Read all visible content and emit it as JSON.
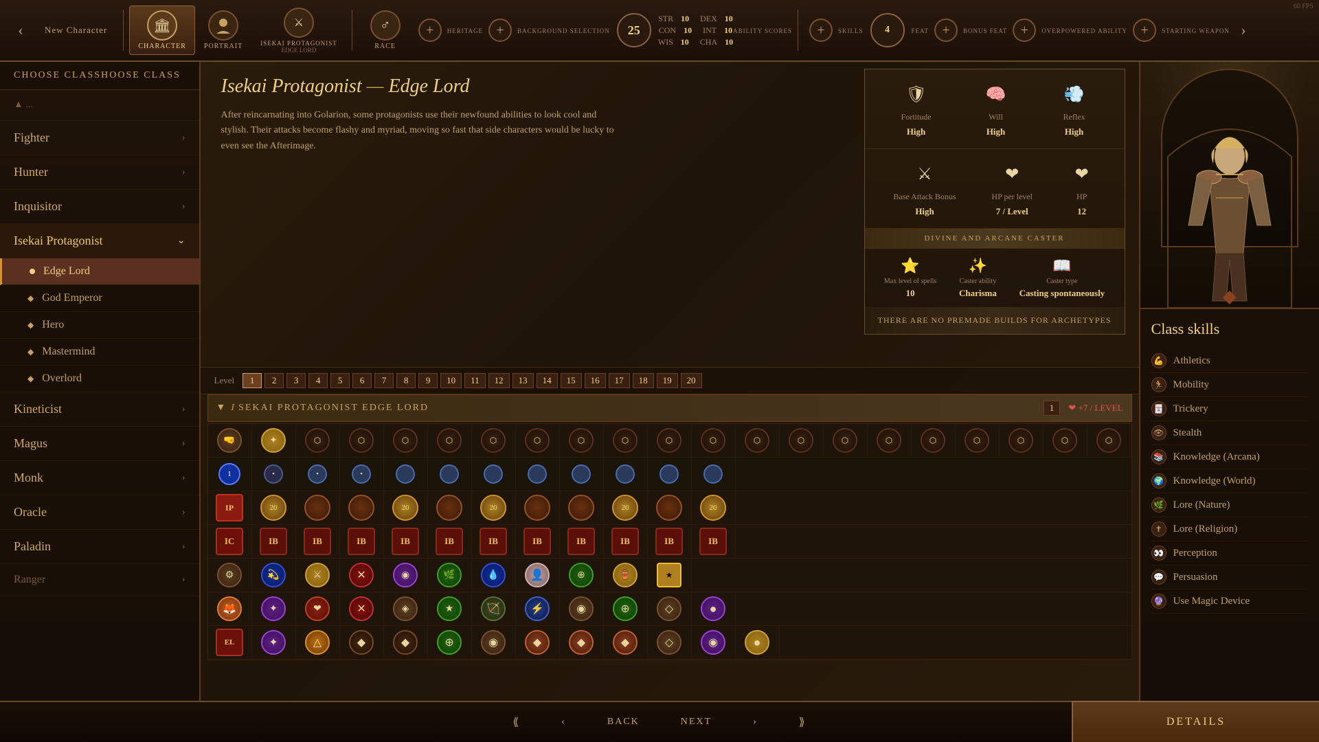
{
  "fps": "60 FPS",
  "header": {
    "new_char_label": "New Character",
    "tabs": [
      {
        "id": "character",
        "label": "CHARACTER",
        "subtitle": "",
        "icon": "🏛",
        "active": true
      },
      {
        "id": "portrait",
        "label": "PORTRAIT",
        "subtitle": "",
        "icon": "👤",
        "active": false
      },
      {
        "id": "protagonist",
        "label": "ISEKAI PROTAGONIST",
        "subtitle": "EDGE LORD",
        "icon": "⚔",
        "active": false
      },
      {
        "id": "race",
        "label": "RACE",
        "subtitle": "",
        "icon": "♂",
        "active": false
      }
    ],
    "plus_buttons": 4,
    "ability_scores_label": "ABILITY SCORES",
    "skills_label": "SKILLS",
    "feat_label": "FEAT",
    "bonus_feat_label": "BONUS FEAT",
    "overpowered_ability_label": "OVERPOWERED ABILITY",
    "starting_weapon_label": "STARTING WEAPON",
    "stats": {
      "STR": 10,
      "DEX": 10,
      "CON": 10,
      "INT": 10,
      "WIS": 10,
      "CHA": 10
    },
    "bg_selection_label": "BACKGROUND SELECTION",
    "circle_25": 25,
    "circle_4": 4
  },
  "left_panel": {
    "choose_class_label": "CHOOSE CLASS",
    "classes": [
      {
        "name": "Fighter",
        "expanded": false
      },
      {
        "name": "Hunter",
        "expanded": false
      },
      {
        "name": "Inquisitor",
        "expanded": false
      },
      {
        "name": "Isekai Protagonist",
        "expanded": true,
        "subclasses": [
          {
            "name": "Edge Lord",
            "selected": true
          },
          {
            "name": "God Emperor",
            "selected": false
          },
          {
            "name": "Hero",
            "selected": false
          },
          {
            "name": "Mastermind",
            "selected": false
          },
          {
            "name": "Overlord",
            "selected": false
          }
        ]
      },
      {
        "name": "Kineticist",
        "expanded": false
      },
      {
        "name": "Magus",
        "expanded": false
      },
      {
        "name": "Monk",
        "expanded": false
      },
      {
        "name": "Oracle",
        "expanded": false
      },
      {
        "name": "Paladin",
        "expanded": false
      },
      {
        "name": "Ranger",
        "expanded": false
      }
    ]
  },
  "center_panel": {
    "class_title": "Isekai Protagonist",
    "class_subtitle": "Edge Lord",
    "description": "After reincarnating into Golarion, some protagonists use their newfound abilities to look cool and stylish. Their attacks become flashy and myriad, moving so fast that side characters would be lucky to even see the Afterimage.",
    "stats": {
      "fortitude_label": "Fortitude",
      "fortitude_value": "High",
      "will_label": "Will",
      "will_value": "High",
      "reflex_label": "Reflex",
      "reflex_value": "High",
      "base_attack_label": "Base Attack Bonus",
      "base_attack_value": "High",
      "hp_level_label": "HP per level",
      "hp_level_value": "7 / Level",
      "hp_label": "HP",
      "hp_value": "12",
      "divine_label": "DIVINE AND ARCANE CASTER",
      "max_spells_label": "Max level of spells",
      "max_spells_value": "10",
      "caster_ability_label": "Caster ability",
      "caster_ability_value": "Charisma",
      "caster_type_label": "Caster type",
      "caster_type_value": "Casting spontaneously",
      "no_premade_label": "THERE ARE NO PREMADE BUILDS FOR ARCHETYPES"
    },
    "level_bar": {
      "label": "Level",
      "levels": [
        1,
        2,
        3,
        4,
        5,
        6,
        7,
        8,
        9,
        10,
        11,
        12,
        13,
        14,
        15,
        16,
        17,
        18,
        19,
        20
      ],
      "active": 1
    },
    "skill_table": {
      "header_title": "ISEKAI PROTAGONIST EDGE LORD",
      "header_level": "1",
      "hp_label": "+7 / LEVEL",
      "rows": 6
    }
  },
  "right_panel": {
    "class_skills_title": "Class skills",
    "skills": [
      {
        "name": "Athletics",
        "icon": "💪"
      },
      {
        "name": "Mobility",
        "icon": "🏃"
      },
      {
        "name": "Trickery",
        "icon": "🃏"
      },
      {
        "name": "Stealth",
        "icon": "👁"
      },
      {
        "name": "Knowledge (Arcana)",
        "icon": "📚"
      },
      {
        "name": "Knowledge (World)",
        "icon": "🌍"
      },
      {
        "name": "Lore (Nature)",
        "icon": "🌿"
      },
      {
        "name": "Lore (Religion)",
        "icon": "✝"
      },
      {
        "name": "Perception",
        "icon": "👀"
      },
      {
        "name": "Persuasion",
        "icon": "💬"
      },
      {
        "name": "Use Magic Device",
        "icon": "🔮"
      }
    ]
  },
  "bottom_bar": {
    "back_label": "BACK",
    "next_label": "NEXT",
    "details_label": "DETAILS"
  }
}
